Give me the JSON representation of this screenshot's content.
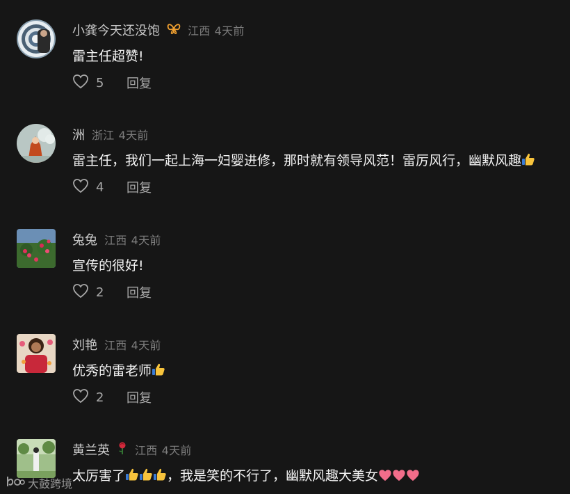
{
  "comments": [
    {
      "username": "小龚今天还没饱",
      "badge": "butterfly-icon",
      "location": "江西",
      "time": "4天前",
      "text": "雷主任超赞!",
      "likes": "5",
      "reply_label": "回复"
    },
    {
      "username": "洲",
      "location": "浙江",
      "time": "4天前",
      "text": "雷主任，我们一起上海一妇婴进修，那时就有领导风范！雷厉风行，幽默风趣",
      "text_emoji": "thumbs-up-icon",
      "likes": "4",
      "reply_label": "回复"
    },
    {
      "username": "兔兔",
      "location": "江西",
      "time": "4天前",
      "text": "宣传的很好!",
      "likes": "2",
      "reply_label": "回复"
    },
    {
      "username": "刘艳",
      "location": "江西",
      "time": "4天前",
      "text": "优秀的雷老师",
      "text_emoji": "thumbs-up-icon",
      "likes": "2",
      "reply_label": "回复"
    },
    {
      "username": "黄兰英",
      "badge": "rose-icon",
      "location": "江西",
      "time": "4天前",
      "text_part1": "太厉害了",
      "text_part2": "，我是笑的不行了，幽默风趣大美女",
      "emojis_part1": [
        "thumbs-up-icon",
        "thumbs-up-icon",
        "thumbs-up-icon"
      ],
      "emojis_part2": [
        "heart-icon",
        "heart-icon",
        "heart-icon"
      ]
    }
  ],
  "watermark": {
    "text": "大鼓跨境"
  },
  "colors": {
    "background": "#161616",
    "username": "#c9c9c9",
    "meta": "#7d7d7d",
    "body_text": "#f3f3f3"
  }
}
